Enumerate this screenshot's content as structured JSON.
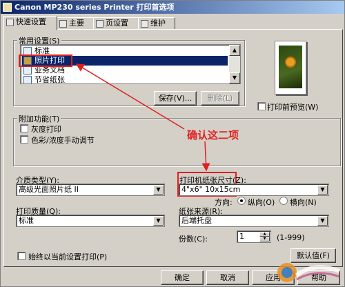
{
  "window": {
    "title": "Canon MP230 series Printer 打印首选项"
  },
  "tabs": [
    {
      "label": "快速设置",
      "icon": "quick-setup-icon",
      "active": true
    },
    {
      "label": "主要",
      "icon": "main-icon",
      "active": false
    },
    {
      "label": "页设置",
      "icon": "page-setup-icon",
      "active": false
    },
    {
      "label": "维护",
      "icon": "maintenance-icon",
      "active": false
    }
  ],
  "common_settings": {
    "label": "常用设置(S)",
    "items": [
      {
        "label": "标准",
        "icon": "standard-icon"
      },
      {
        "label": "照片打印",
        "icon": "photo-print-icon",
        "selected": true
      },
      {
        "label": "业务文档",
        "icon": "business-doc-icon"
      },
      {
        "label": "节省纸张",
        "icon": "paper-saving-icon"
      }
    ],
    "save_button": "保存(V)...",
    "delete_button": "删除(L)"
  },
  "preview": {
    "checkbox_label": "打印前预览(W)",
    "checked": false
  },
  "additional": {
    "label": "附加功能(T)",
    "grayscale": {
      "label": "灰度打印",
      "checked": false
    },
    "color_adjust": {
      "label": "色彩/浓度手动调节",
      "checked": false
    }
  },
  "media_type": {
    "label": "介质类型(Y):",
    "value": "高级光面照片纸 II"
  },
  "paper_size": {
    "label": "打印机纸张尺寸(Z):",
    "value": "4\"x6\" 10x15cm"
  },
  "orientation": {
    "label": "方向:",
    "portrait": "纵向(O)",
    "landscape": "横向(N)",
    "selected": "portrait"
  },
  "print_quality": {
    "label": "打印质量(Q):",
    "value": "标准"
  },
  "paper_source": {
    "label": "纸张来源(R):",
    "value": "后端托盘"
  },
  "copies": {
    "label": "份数(C):",
    "value": "1",
    "range": "(1-999)"
  },
  "always_print": {
    "label": "始终以当前设置打印(P)",
    "checked": false
  },
  "defaults_button": "默认值(F)",
  "footer": {
    "ok": "确定",
    "cancel": "取消",
    "apply": "应用",
    "help": "帮助"
  },
  "annotation": {
    "text": "确认这二项",
    "color": "#e02020"
  },
  "colors": {
    "titlebar_start": "#0a246a",
    "titlebar_end": "#a6caf0",
    "selection": "#0a246a",
    "face": "#d4d0c8"
  }
}
